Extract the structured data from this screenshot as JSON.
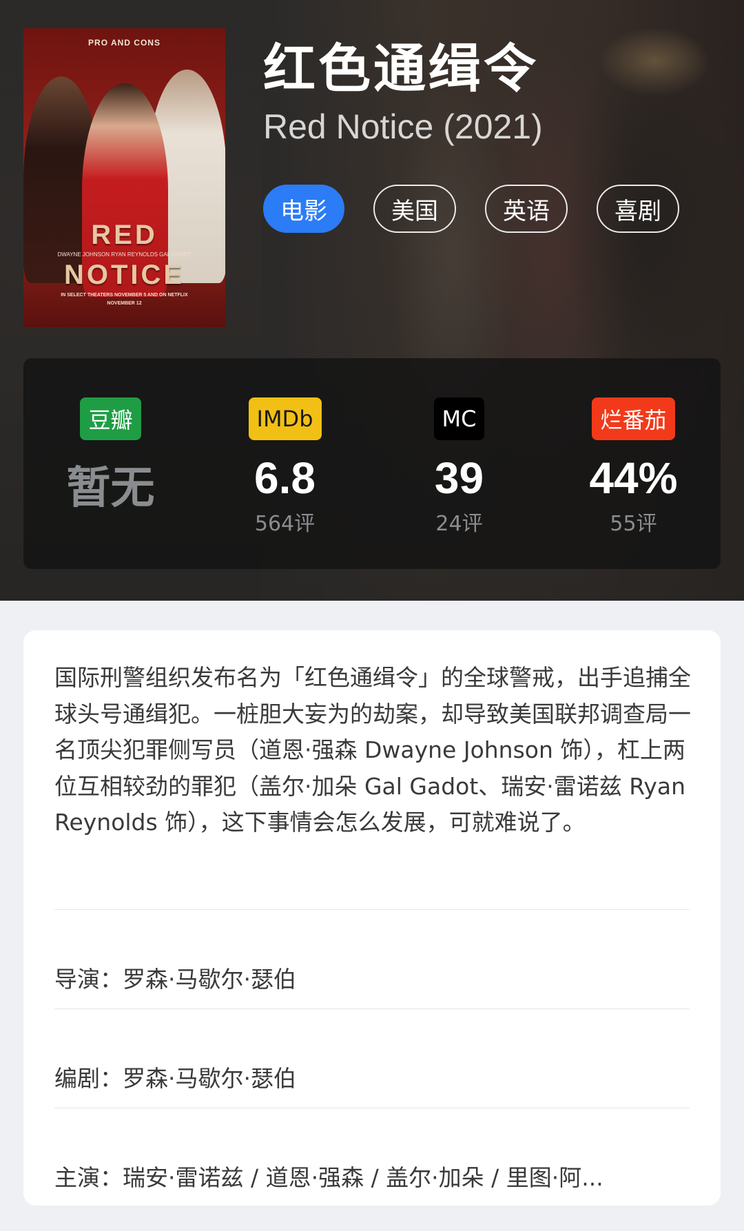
{
  "movie": {
    "title_cn": "红色通缉令",
    "title_en": "Red Notice (2021)",
    "tags": [
      {
        "label": "电影",
        "primary": true
      },
      {
        "label": "美国",
        "primary": false
      },
      {
        "label": "英语",
        "primary": false
      },
      {
        "label": "喜剧",
        "primary": false
      }
    ]
  },
  "poster": {
    "tagline": "PRO AND CONS",
    "title_line1": "RED",
    "title_line2": "NOTICE",
    "cast": "DWAYNE JOHNSON   RYAN REYNOLDS   GAL GADOT",
    "release": "IN SELECT THEATERS NOVEMBER 5 AND ON NETFLIX",
    "date": "NOVEMBER 12"
  },
  "ratings": [
    {
      "source": "豆瓣",
      "score": "暂无",
      "count": ""
    },
    {
      "source": "IMDb",
      "score": "6.8",
      "count": "564评"
    },
    {
      "source": "MC",
      "score": "39",
      "count": "24评"
    },
    {
      "source": "烂番茄",
      "score": "44%",
      "count": "55评"
    }
  ],
  "colors": {
    "douban": "#1f9d45",
    "imdb": "#f2c014",
    "mc": "#000000",
    "rt": "#f23a1a",
    "tag_primary": "#2b7cf6"
  },
  "details": {
    "synopsis": "国际刑警组织发布名为「红色通缉令」的全球警戒，出手追捕全球头号通缉犯。一桩胆大妄为的劫案，却导致美国联邦调查局一名顶尖犯罪侧写员（道恩·强森 Dwayne Johnson 饰），杠上两位互相较劲的罪犯（盖尔·加朵 Gal Gadot、瑞安·雷诺兹 Ryan Reynolds 饰），这下事情会怎么发展，可就难说了。",
    "director_label": "导演：",
    "director": "罗森·马歇尔·瑟伯",
    "writer_label": "编剧：",
    "writer": "罗森·马歇尔·瑟伯",
    "cast_label": "主演：",
    "cast": "瑞安·雷诺兹 / 道恩·强森 / 盖尔·加朵 / 里图·阿..."
  }
}
